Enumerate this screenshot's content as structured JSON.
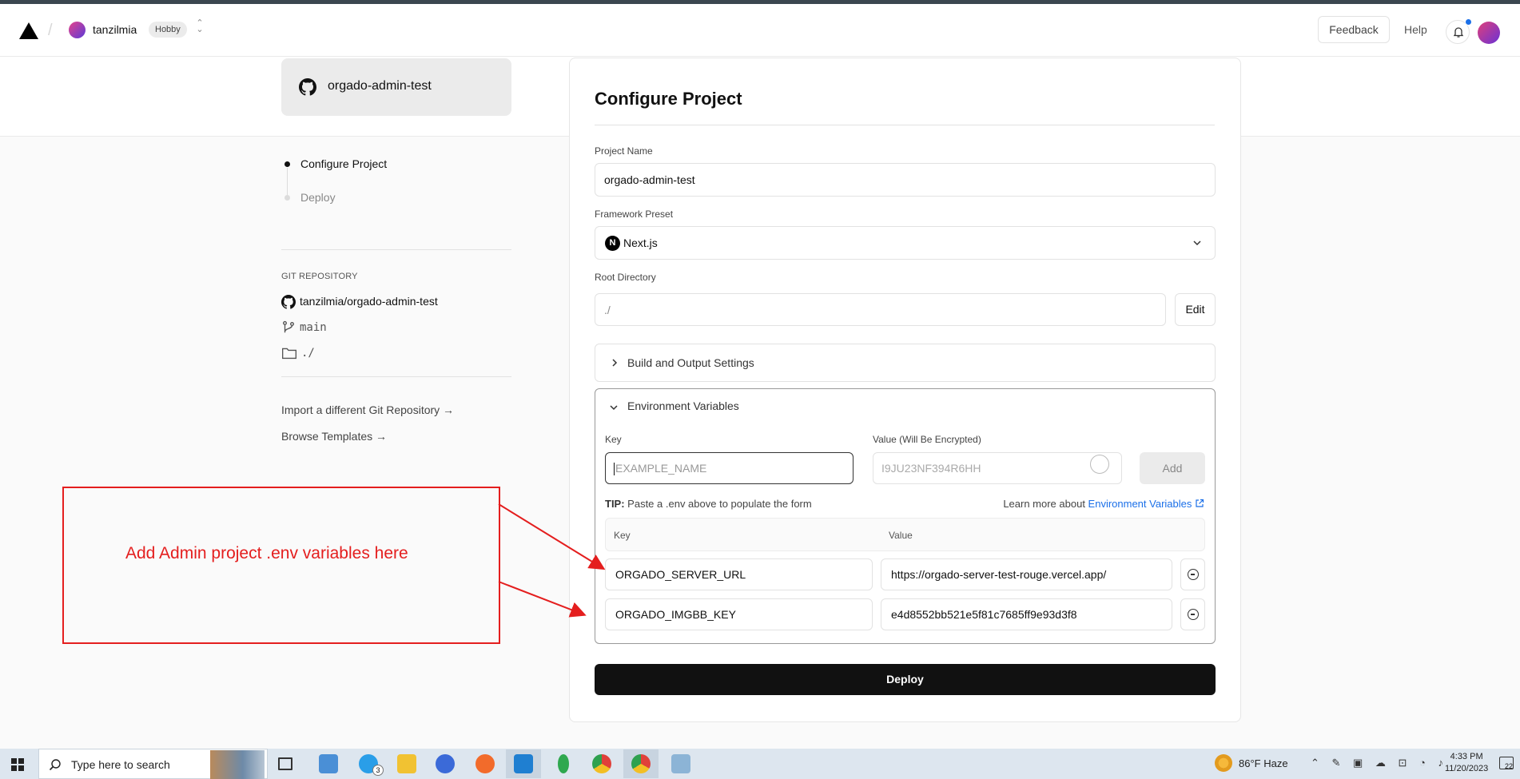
{
  "header": {
    "team_name": "tanzilmia",
    "plan": "Hobby",
    "feedback": "Feedback",
    "help": "Help"
  },
  "repo_card": {
    "name": "orgado-admin-test"
  },
  "steps": [
    "Configure Project",
    "Deploy"
  ],
  "git": {
    "label": "GIT REPOSITORY",
    "repo": "tanzilmia/orgado-admin-test",
    "branch": "main",
    "directory": "./"
  },
  "links": {
    "import": "Import a different Git Repository →",
    "templates": "Browse Templates →"
  },
  "config": {
    "title": "Configure Project",
    "project_name_label": "Project Name",
    "project_name": "orgado-admin-test",
    "framework_label": "Framework Preset",
    "framework": "Next.js",
    "root_label": "Root Directory",
    "root_value": "./",
    "edit": "Edit",
    "build_settings": "Build and Output Settings",
    "deploy": "Deploy"
  },
  "env": {
    "title": "Environment Variables",
    "key_label": "Key",
    "value_label": "Value (Will Be Encrypted)",
    "key_placeholder": "EXAMPLE_NAME",
    "value_placeholder": "I9JU23NF394R6HH",
    "add": "Add",
    "tip_bold": "TIP:",
    "tip_text": " Paste a .env above to populate the form",
    "learn_prefix": "Learn more about ",
    "learn_link": "Environment Variables",
    "table_key": "Key",
    "table_value": "Value",
    "rows": [
      {
        "key": "ORGADO_SERVER_URL",
        "value": "https://orgado-server-test-rouge.vercel.app/"
      },
      {
        "key": "ORGADO_IMGBB_KEY",
        "value": "e4d8552bb521e5f81c7685ff9e93d3f8"
      }
    ]
  },
  "annotation": {
    "text": "Add Admin project .env variables here",
    "color": "#e41e1e"
  },
  "taskbar": {
    "search_placeholder": "Type here to search",
    "skype_badge": "3",
    "weather": "86°F  Haze",
    "time": "4:33 PM",
    "date": "11/20/2023",
    "notif_count": "22"
  }
}
